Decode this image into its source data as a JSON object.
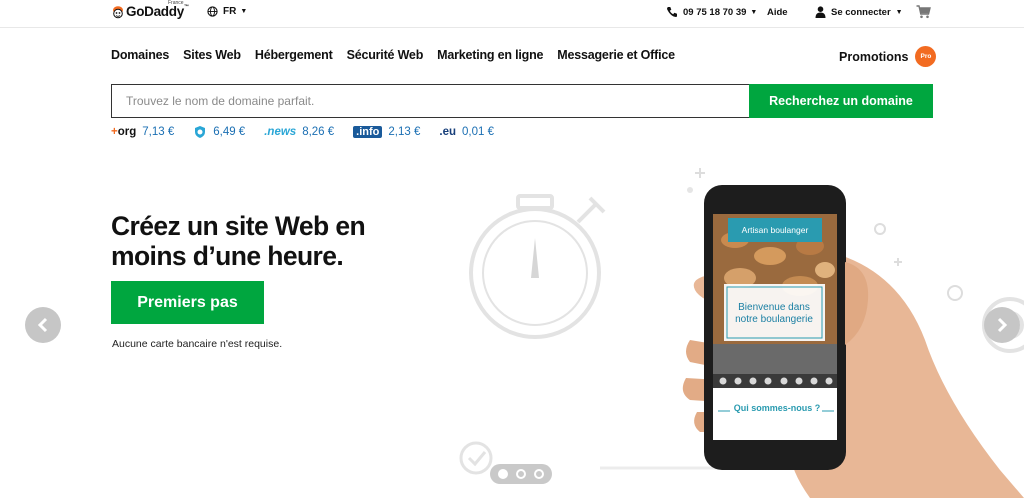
{
  "header": {
    "logo_text": "GoDaddy",
    "logo_tm": "™",
    "logo_country": "France",
    "language": "FR",
    "phone": "09 75 18 70 39",
    "help": "Aide",
    "login": "Se connecter"
  },
  "nav": {
    "items": [
      "Domaines",
      "Sites Web",
      "Hébergement",
      "Sécurité Web",
      "Marketing en ligne",
      "Messagerie et Office"
    ],
    "promotions": "Promotions",
    "pro_badge": "Pro"
  },
  "search": {
    "placeholder": "Trouvez le nom de domaine parfait.",
    "value": "",
    "button": "Recherchez un domaine"
  },
  "tlds": [
    {
      "name": "org",
      "prefix": "+",
      "price": "7,13 €"
    },
    {
      "name": "",
      "price": "6,49 €"
    },
    {
      "name": ".news",
      "price": "8,26 €"
    },
    {
      "name": ".info",
      "price": "2,13 €"
    },
    {
      "name": ".eu",
      "price": "0,01 €"
    }
  ],
  "hero": {
    "title_line1": "Créez un site Web en",
    "title_line2": "moins d’une heure.",
    "cta": "Premiers pas",
    "note": "Aucune carte bancaire n'est requise."
  },
  "phone_screen": {
    "banner": "Artisan boulanger",
    "welcome_line1": "Bienvenue dans",
    "welcome_line2": "notre boulangerie",
    "about": "Qui sommes-nous ?"
  },
  "carousel": {
    "slides": 3,
    "active": 1
  },
  "colors": {
    "brand_green": "#00a63f",
    "promo_orange": "#f26b21",
    "price_blue": "#1b6fb3",
    "screen_teal": "#2a9bb0"
  }
}
